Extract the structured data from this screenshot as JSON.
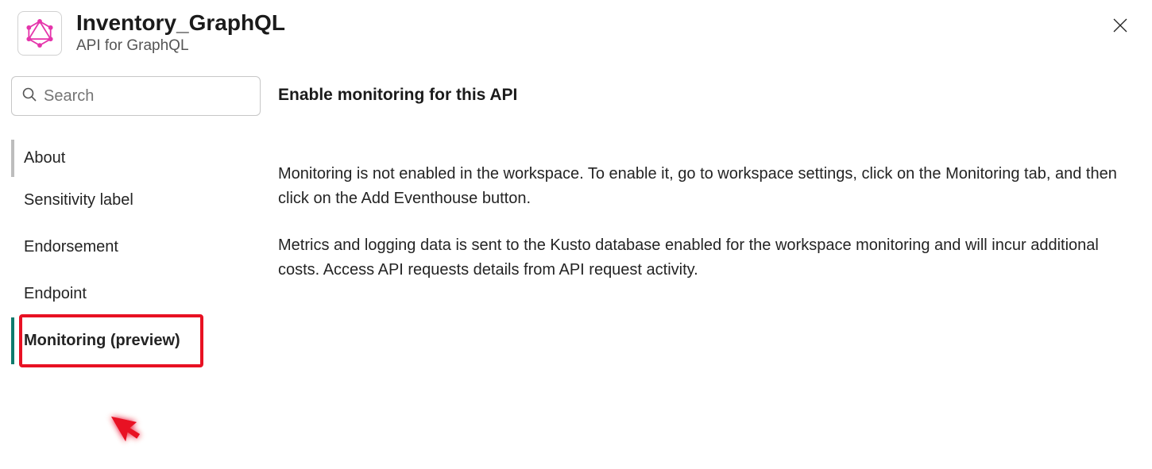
{
  "header": {
    "title": "Inventory_GraphQL",
    "subtitle": "API for GraphQL"
  },
  "search": {
    "placeholder": "Search"
  },
  "sidebar": {
    "items": [
      {
        "label": "About"
      },
      {
        "label": "Sensitivity label"
      },
      {
        "label": "Endorsement"
      },
      {
        "label": "Endpoint"
      },
      {
        "label": "Monitoring (preview)"
      }
    ]
  },
  "content": {
    "heading": "Enable monitoring for this API",
    "para1": "Monitoring is not enabled in the workspace. To enable it, go to workspace settings, click on the Monitoring tab, and then click on the Add Eventhouse button.",
    "para2": "Metrics and logging data is sent to the Kusto database enabled for the workspace monitoring and will incur additional costs. Access API requests details from API request activity."
  }
}
